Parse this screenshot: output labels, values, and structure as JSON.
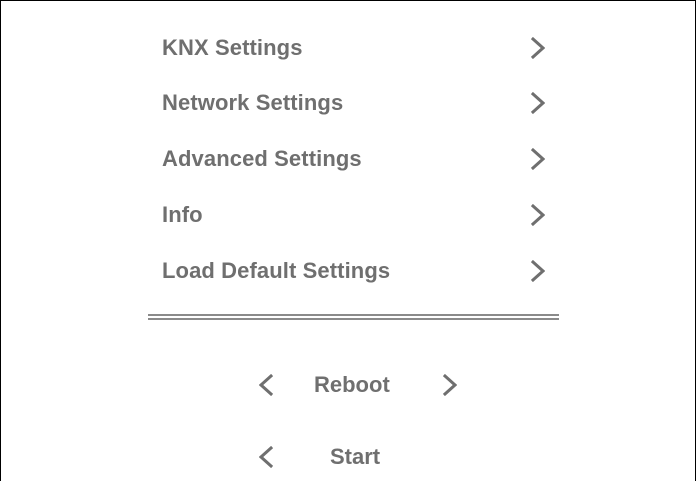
{
  "menu": {
    "items": [
      {
        "label": "KNX Settings",
        "icon": "chevron-right-icon"
      },
      {
        "label": "Network Settings",
        "icon": "chevron-right-icon"
      },
      {
        "label": "Advanced Settings",
        "icon": "chevron-right-icon"
      },
      {
        "label": "Info",
        "icon": "chevron-right-icon"
      },
      {
        "label": "Load Default Settings",
        "icon": "chevron-right-icon"
      }
    ]
  },
  "reboot": {
    "label": "Reboot",
    "prev_icon": "chevron-left-icon",
    "next_icon": "chevron-right-icon"
  },
  "start": {
    "label": "Start",
    "prev_icon": "chevron-left-icon"
  },
  "colors": {
    "text": "#6f6f6f",
    "chevron": "#6f6f6f",
    "divider": "#8a8a8a",
    "border": "#000000",
    "background": "#ffffff"
  }
}
